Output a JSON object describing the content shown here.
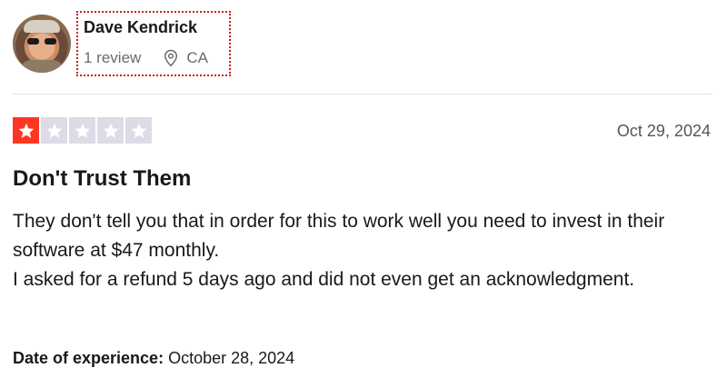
{
  "consumer": {
    "name": "Dave Kendrick",
    "reviews": "1 review",
    "location": "CA"
  },
  "review": {
    "rating": 1,
    "rating_max": 5,
    "date": "Oct 29, 2024",
    "title": "Don't Trust Them",
    "body": [
      "They don't tell you that in order for this to work well you need to invest in their software at $47 monthly.",
      "I asked for a refund 5 days ago and did not even get an acknowledgment."
    ],
    "experience_label": "Date of experience:",
    "experience_date": "October 28, 2024"
  },
  "colors": {
    "star_filled": "#ff3722",
    "star_empty": "#dcdce6",
    "highlight_border": "#d01919"
  }
}
